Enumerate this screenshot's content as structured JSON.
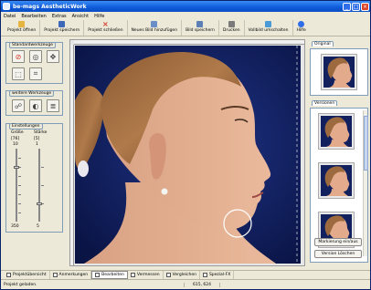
{
  "window": {
    "title": "be-mags AestheticWork"
  },
  "menu": {
    "items": [
      "Datei",
      "Bearbeiten",
      "Extras",
      "Ansicht",
      "Hilfe"
    ]
  },
  "toolbar": {
    "buttons": [
      {
        "label": "Projekt öffnen",
        "icon": "folder-open-icon",
        "color": "#e6b440"
      },
      {
        "label": "Projekt speichern",
        "icon": "save-icon",
        "color": "#3d67b8"
      },
      {
        "label": "Projekt schließen",
        "icon": "close-x-icon",
        "color": "#d23a2a"
      },
      {
        "label": "Neues Bild hinzufügen",
        "icon": "add-image-icon",
        "color": "#6a8fc8"
      },
      {
        "label": "Bild speichern",
        "icon": "save-image-icon",
        "color": "#5c7fb5"
      },
      {
        "label": "Drucken",
        "icon": "printer-icon",
        "color": "#7a7a7a"
      },
      {
        "label": "Vollbild umschalten",
        "icon": "fullscreen-icon",
        "color": "#4a9ad8"
      },
      {
        "label": "Hilfe",
        "icon": "help-icon",
        "color": "#2f6ee8"
      }
    ]
  },
  "left": {
    "standard_tools": {
      "label": "Standardwerkzeuge"
    },
    "further_tools": {
      "label": "weitere Werkzeuge"
    },
    "settings": {
      "label": "Einstellungen",
      "size_label": "Größe",
      "strength_label": "Stärke",
      "size_value": "[76]",
      "strength_value": "[5]",
      "size_top": "10",
      "strength_top": "1",
      "size_bottom": "350",
      "strength_bottom": "5",
      "size_level": 0.25,
      "strength_level": 0.75
    }
  },
  "right": {
    "original_tab": "Original",
    "versions_tab": "Versionen",
    "mark_button": "Markierung ein/aus",
    "delete_button": "Version Löschen"
  },
  "bottom_tabs": [
    {
      "label": "Projektübersicht",
      "icon": "overview-icon"
    },
    {
      "label": "Anmerkungen",
      "icon": "notes-icon"
    },
    {
      "label": "Bearbeiten",
      "icon": "edit-icon",
      "active": true
    },
    {
      "label": "Vermessen",
      "icon": "measure-icon"
    },
    {
      "label": "Vergleichen",
      "icon": "compare-icon"
    },
    {
      "label": "Spezial-FX",
      "icon": "special-fx-icon"
    }
  ],
  "status": {
    "message": "Projekt geladen.",
    "coords": "615, 624"
  }
}
